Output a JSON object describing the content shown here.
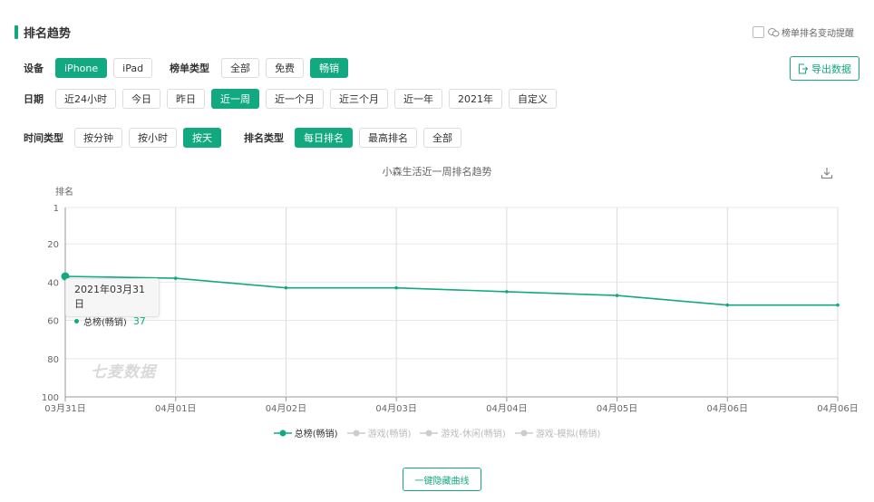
{
  "header": {
    "title": "排名趋势",
    "alert_label": "榜单排名变动提醒",
    "export_label": "导出数据"
  },
  "filters": {
    "device": {
      "label": "设备",
      "options": [
        "iPhone",
        "iPad"
      ],
      "active": 0
    },
    "list_type": {
      "label": "榜单类型",
      "options": [
        "全部",
        "免费",
        "畅销"
      ],
      "active": 2
    },
    "date": {
      "label": "日期",
      "options": [
        "近24小时",
        "今日",
        "昨日",
        "近一周",
        "近一个月",
        "近三个月",
        "近一年",
        "2021年",
        "自定义"
      ],
      "active": 3
    },
    "time_type": {
      "label": "时间类型",
      "options": [
        "按分钟",
        "按小时",
        "按天"
      ],
      "active": 2
    },
    "rank_type": {
      "label": "排名类型",
      "options": [
        "每日排名",
        "最高排名",
        "全部"
      ],
      "active": 0
    }
  },
  "tooltip": {
    "date": "2021年03月31日",
    "series": "总榜(畅销)",
    "value": "37"
  },
  "watermark": "七麦数据",
  "hide_button_label": "一键隐藏曲线",
  "colors": {
    "accent": "#12a981",
    "inactive": "#cccccc"
  },
  "chart_data": {
    "type": "line",
    "title": "小森生活近一周排名趋势",
    "ylabel": "排名",
    "y_inverted": true,
    "ylim": [
      1,
      100
    ],
    "yticks": [
      1,
      20,
      40,
      60,
      80,
      100
    ],
    "x": [
      "03月31日",
      "04月01日",
      "04月02日",
      "04月03日",
      "04月04日",
      "04月05日",
      "04月06日",
      "04月06日"
    ],
    "series": [
      {
        "name": "总榜(畅销)",
        "values": [
          37,
          38,
          43,
          43,
          45,
          47,
          52,
          52
        ],
        "visible": true,
        "color": "#12a981"
      },
      {
        "name": "游戏(畅销)",
        "values": [],
        "visible": false,
        "color": "#cccccc"
      },
      {
        "name": "游戏-休闲(畅销)",
        "values": [],
        "visible": false,
        "color": "#cccccc"
      },
      {
        "name": "游戏-模拟(畅销)",
        "values": [],
        "visible": false,
        "color": "#cccccc"
      }
    ],
    "grid": true,
    "legend": "bottom"
  }
}
